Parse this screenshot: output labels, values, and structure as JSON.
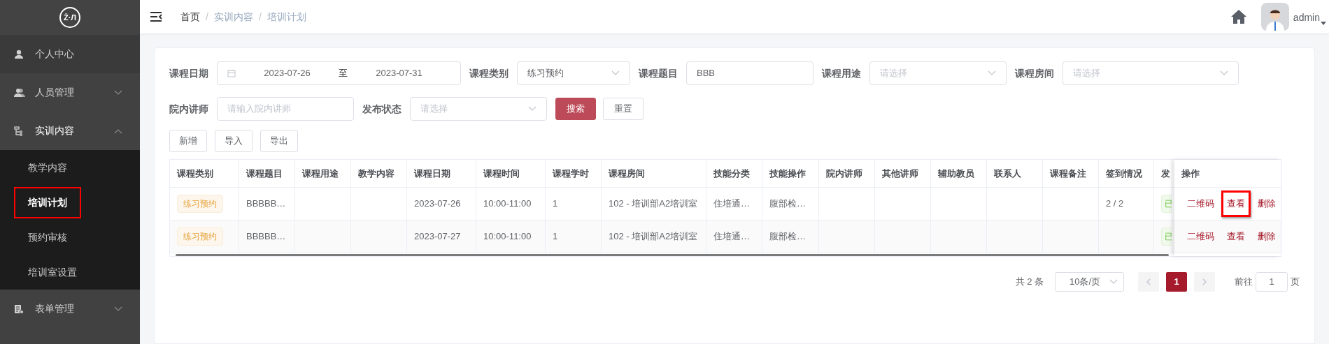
{
  "sidebar": {
    "logo": "Ż·Л",
    "items": [
      {
        "label": "个人中心",
        "kind": "link"
      },
      {
        "label": "人员管理",
        "kind": "submenu",
        "expanded": false
      },
      {
        "label": "实训内容",
        "kind": "submenu",
        "expanded": true,
        "children": [
          {
            "label": "教学内容",
            "selected": false,
            "highlighted": false
          },
          {
            "label": "培训计划",
            "selected": true,
            "highlighted": true
          },
          {
            "label": "预约审核",
            "selected": false,
            "highlighted": false
          },
          {
            "label": "培训室设置",
            "selected": false,
            "highlighted": false
          }
        ]
      },
      {
        "label": "表单管理",
        "kind": "submenu",
        "expanded": false
      }
    ]
  },
  "header": {
    "breadcrumb": [
      "首页",
      "实训内容",
      "培训计划"
    ],
    "separator": "/",
    "user": "admin"
  },
  "filters": [
    [
      {
        "kind": "daterange",
        "label": "课程日期",
        "start": "2023-07-26",
        "separator": "至",
        "end": "2023-07-31"
      },
      {
        "kind": "select",
        "label": "课程类别",
        "value": "练习预约"
      },
      {
        "kind": "input",
        "label": "课程题目",
        "value": "BBB"
      },
      {
        "kind": "select",
        "label": "课程用途",
        "placeholder": "请选择"
      },
      {
        "kind": "select",
        "label": "课程房间",
        "placeholder": "请选择"
      }
    ],
    [
      {
        "kind": "input",
        "label": "院内讲师",
        "placeholder": "请输入院内讲师"
      },
      {
        "kind": "select",
        "label": "发布状态",
        "placeholder": "请选择"
      }
    ]
  ],
  "filter_buttons": [
    {
      "label": "搜索",
      "kind": "primary"
    },
    {
      "label": "重置",
      "kind": "default"
    }
  ],
  "toolbar": [
    "新增",
    "导入",
    "导出"
  ],
  "table": {
    "columns": [
      "课程类别",
      "课程题目",
      "课程用途",
      "教学内容",
      "课程日期",
      "课程时间",
      "课程学时",
      "课程房间",
      "技能分类",
      "技能操作",
      "院内讲师",
      "其他讲师",
      "辅助教员",
      "联系人",
      "课程备注",
      "签到情况",
      "发"
    ],
    "action_column": "操作",
    "rows": [
      {
        "category": "练习预约",
        "title": "BBBBB…",
        "date": "2023-07-26",
        "time": "10:00-11:00",
        "hours": "1",
        "room": "102 - 培训部A2培训室",
        "skill_category": "住培通…",
        "skill_operation": "腹部检…",
        "sign_in": "2 / 2",
        "status": "已",
        "actions": [
          {
            "label": "二维码",
            "highlighted": false
          },
          {
            "label": "查看",
            "highlighted": true
          },
          {
            "label": "删除",
            "highlighted": false
          }
        ]
      },
      {
        "category": "练习预约",
        "title": "BBBBB…",
        "date": "2023-07-27",
        "time": "10:00-11:00",
        "hours": "1",
        "room": "102 - 培训部A2培训室",
        "skill_category": "住培通…",
        "skill_operation": "腹部检…",
        "status": "已",
        "actions": [
          {
            "label": "二维码",
            "highlighted": false
          },
          {
            "label": "查看",
            "highlighted": false
          },
          {
            "label": "删除",
            "highlighted": false
          }
        ]
      }
    ]
  },
  "pagination": {
    "total": "共 2 条",
    "page_size": "10条/页",
    "pages": [
      {
        "label": "1",
        "selected": true
      }
    ],
    "goto_label": "前往",
    "goto_value": "1",
    "goto_suffix": "页"
  }
}
